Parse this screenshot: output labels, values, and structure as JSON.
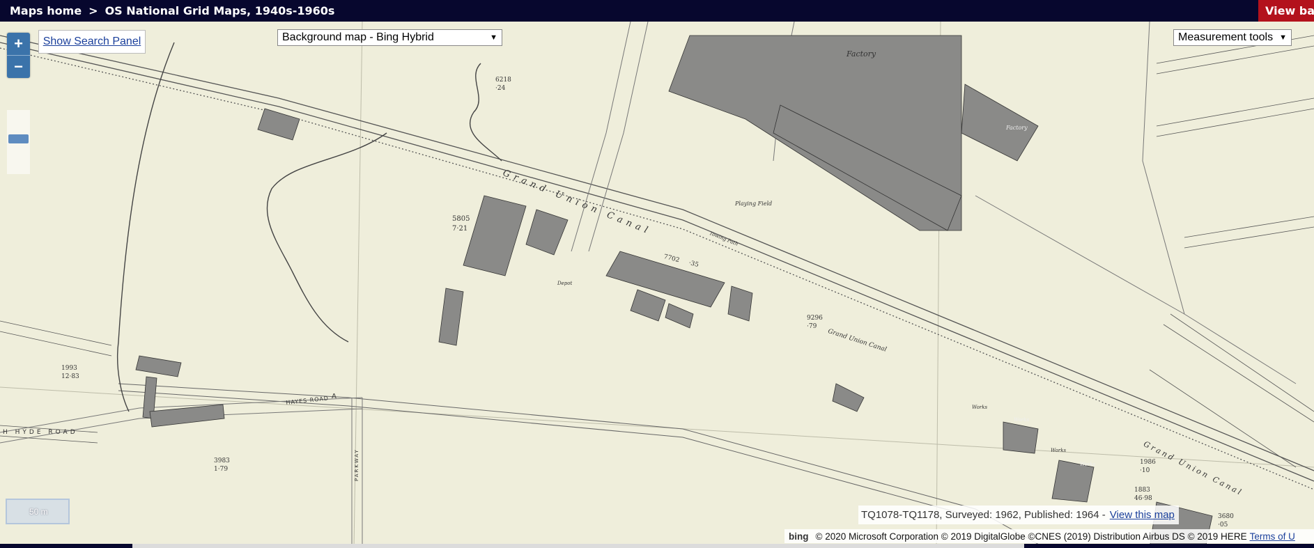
{
  "breadcrumb": {
    "home": "Maps home",
    "separator": ">",
    "current": "OS National Grid Maps, 1940s-1960s"
  },
  "view_base_button": "View basi",
  "zoom": {
    "in": "+",
    "out": "−"
  },
  "search_panel_link": "Show Search Panel",
  "background_select": {
    "value": "Background map - Bing Hybrid",
    "arrow": "▼"
  },
  "measurement_select": {
    "value": "Measurement tools",
    "arrow": "▼"
  },
  "scale_label": "50 m",
  "map_info": {
    "text": "TQ1078-TQ1178, Surveyed: 1962, Published: 1964  -",
    "link": "View this map"
  },
  "attribution": {
    "bing": "bing",
    "text": "© 2020 Microsoft Corporation © 2019 DigitalGlobe ©CNES (2019) Distribution Airbus DS © 2019 HERE",
    "terms": "Terms of U"
  },
  "map_labels": {
    "factory1": "Factory",
    "factory2": "Factory",
    "grand_union_canal_1": "Grand Union Canal",
    "grand_union_canal_2": "Grand Union Canal",
    "grand_union_canal_3": "Grand Union Canal",
    "playing_field": "Playing Field",
    "towing_path": "Towing Path",
    "depot": "Depot",
    "hayes_road": "HAYES ROAD",
    "hyde_road": "H  HYDE  ROAD",
    "parkway": "PARKWAY",
    "works1": "Works",
    "works2": "Works",
    "works3": "Works",
    "works4": "Works",
    "parcel_5805": "5805",
    "parcel_5805_area": "7·21",
    "parcel_6218": "6218",
    "parcel_6218_area": "·24",
    "parcel_7702": "7702",
    "parcel_7702_area": "·35",
    "parcel_9296": "9296",
    "parcel_9296_area": "·79",
    "parcel_1993": "1993",
    "parcel_1993_area": "12·83",
    "parcel_3983": "3983",
    "parcel_3983_area": "1·79",
    "parcel_1986": "1986",
    "parcel_1986_area": "·10",
    "parcel_1883": "1883",
    "parcel_1883_area": "46·98",
    "parcel_3680": "3680",
    "parcel_3680_area": "·05",
    "road_a": "A"
  }
}
